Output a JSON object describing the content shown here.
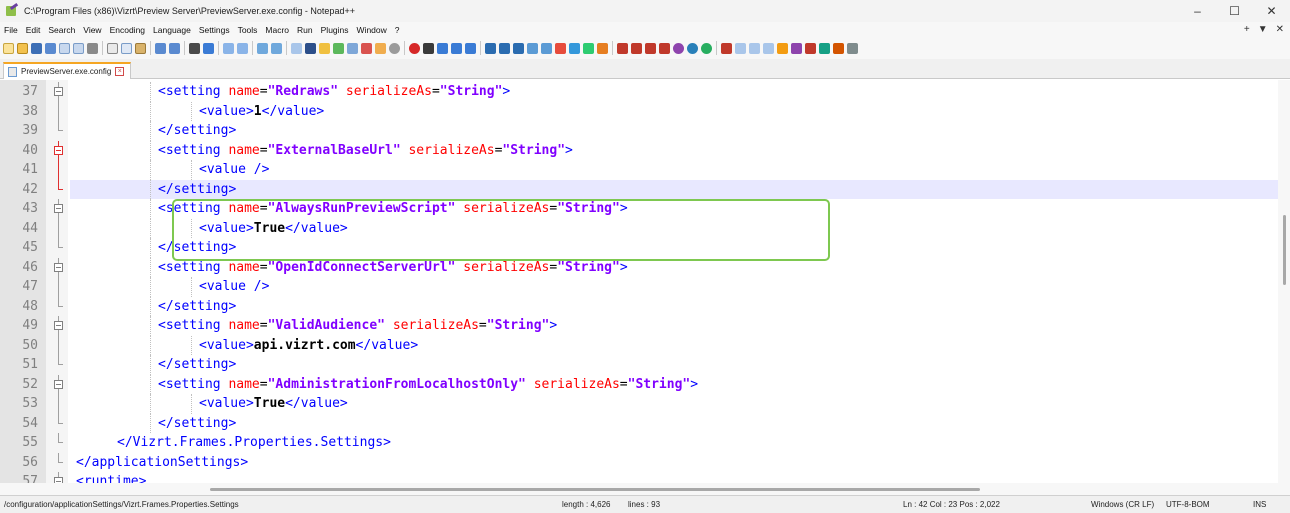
{
  "window": {
    "title": "C:\\Program Files (x86)\\Vizrt\\Preview Server\\PreviewServer.exe.config - Notepad++",
    "controls": [
      "–",
      "☐",
      "✕"
    ]
  },
  "menu": {
    "items": [
      "File",
      "Edit",
      "Search",
      "View",
      "Encoding",
      "Language",
      "Settings",
      "Tools",
      "Macro",
      "Run",
      "Plugins",
      "Window",
      "?"
    ],
    "right": [
      "+",
      "▼",
      "✕"
    ]
  },
  "tab": {
    "label": "PreviewServer.exe.config",
    "close": "×"
  },
  "editor": {
    "lines": [
      {
        "n": "37",
        "indent": 3,
        "parts": [
          [
            "tag",
            "<setting "
          ],
          [
            "attr",
            "name"
          ],
          [
            "eq",
            "="
          ],
          [
            "val",
            "\"Redraws\""
          ],
          [
            "tag",
            " "
          ],
          [
            "attr",
            "serializeAs"
          ],
          [
            "eq",
            "="
          ],
          [
            "val",
            "\"String\""
          ],
          [
            "tag",
            ">"
          ]
        ]
      },
      {
        "n": "38",
        "indent": 4,
        "parts": [
          [
            "tag",
            "<value>"
          ],
          [
            "txt",
            "1"
          ],
          [
            "tag",
            "</value>"
          ]
        ]
      },
      {
        "n": "39",
        "indent": 3,
        "parts": [
          [
            "tag",
            "</setting>"
          ]
        ]
      },
      {
        "n": "40",
        "indent": 3,
        "parts": [
          [
            "tag",
            "<setting "
          ],
          [
            "attr",
            "name"
          ],
          [
            "eq",
            "="
          ],
          [
            "val",
            "\"ExternalBaseUrl\""
          ],
          [
            "tag",
            " "
          ],
          [
            "attr",
            "serializeAs"
          ],
          [
            "eq",
            "="
          ],
          [
            "val",
            "\"String\""
          ],
          [
            "tag",
            ">"
          ]
        ]
      },
      {
        "n": "41",
        "indent": 4,
        "parts": [
          [
            "tag",
            "<value />"
          ]
        ]
      },
      {
        "n": "42",
        "indent": 3,
        "parts": [
          [
            "tag",
            "</setting>"
          ]
        ]
      },
      {
        "n": "43",
        "indent": 3,
        "parts": [
          [
            "tag",
            "<setting "
          ],
          [
            "attr",
            "name"
          ],
          [
            "eq",
            "="
          ],
          [
            "val",
            "\"AlwaysRunPreviewScript\""
          ],
          [
            "tag",
            " "
          ],
          [
            "attr",
            "serializeAs"
          ],
          [
            "eq",
            "="
          ],
          [
            "val",
            "\"String\""
          ],
          [
            "tag",
            ">"
          ]
        ]
      },
      {
        "n": "44",
        "indent": 4,
        "parts": [
          [
            "tag",
            "<value>"
          ],
          [
            "txt",
            "True"
          ],
          [
            "tag",
            "</value>"
          ]
        ]
      },
      {
        "n": "45",
        "indent": 3,
        "parts": [
          [
            "tag",
            "</setting>"
          ]
        ]
      },
      {
        "n": "46",
        "indent": 3,
        "parts": [
          [
            "tag",
            "<setting "
          ],
          [
            "attr",
            "name"
          ],
          [
            "eq",
            "="
          ],
          [
            "val",
            "\"OpenIdConnectServerUrl\""
          ],
          [
            "tag",
            " "
          ],
          [
            "attr",
            "serializeAs"
          ],
          [
            "eq",
            "="
          ],
          [
            "val",
            "\"String\""
          ],
          [
            "tag",
            ">"
          ]
        ]
      },
      {
        "n": "47",
        "indent": 4,
        "parts": [
          [
            "tag",
            "<value />"
          ]
        ]
      },
      {
        "n": "48",
        "indent": 3,
        "parts": [
          [
            "tag",
            "</setting>"
          ]
        ]
      },
      {
        "n": "49",
        "indent": 3,
        "parts": [
          [
            "tag",
            "<setting "
          ],
          [
            "attr",
            "name"
          ],
          [
            "eq",
            "="
          ],
          [
            "val",
            "\"ValidAudience\""
          ],
          [
            "tag",
            " "
          ],
          [
            "attr",
            "serializeAs"
          ],
          [
            "eq",
            "="
          ],
          [
            "val",
            "\"String\""
          ],
          [
            "tag",
            ">"
          ]
        ]
      },
      {
        "n": "50",
        "indent": 4,
        "parts": [
          [
            "tag",
            "<value>"
          ],
          [
            "txt",
            "api.vizrt.com"
          ],
          [
            "tag",
            "</value>"
          ]
        ]
      },
      {
        "n": "51",
        "indent": 3,
        "parts": [
          [
            "tag",
            "</setting>"
          ]
        ]
      },
      {
        "n": "52",
        "indent": 3,
        "parts": [
          [
            "tag",
            "<setting "
          ],
          [
            "attr",
            "name"
          ],
          [
            "eq",
            "="
          ],
          [
            "val",
            "\"AdministrationFromLocalhostOnly\""
          ],
          [
            "tag",
            " "
          ],
          [
            "attr",
            "serializeAs"
          ],
          [
            "eq",
            "="
          ],
          [
            "val",
            "\"String\""
          ],
          [
            "tag",
            ">"
          ]
        ]
      },
      {
        "n": "53",
        "indent": 4,
        "parts": [
          [
            "tag",
            "<value>"
          ],
          [
            "txt",
            "True"
          ],
          [
            "tag",
            "</value>"
          ]
        ]
      },
      {
        "n": "54",
        "indent": 3,
        "parts": [
          [
            "tag",
            "</setting>"
          ]
        ]
      },
      {
        "n": "55",
        "indent": 2,
        "parts": [
          [
            "tag",
            "</Vizrt.Frames.Properties.Settings>"
          ]
        ]
      },
      {
        "n": "56",
        "indent": 1,
        "parts": [
          [
            "tag",
            "</applicationSettings>"
          ]
        ]
      },
      {
        "n": "57",
        "indent": 1,
        "parts": [
          [
            "tag",
            "<runtime>"
          ]
        ]
      }
    ],
    "current_line": "42",
    "highlighted_lines": [
      "43",
      "44",
      "45"
    ]
  },
  "status": {
    "path": "/configuration/applicationSettings/Vizrt.Frames.Properties.Settings",
    "length": "length : 4,626",
    "lines": "lines : 93",
    "cursor": "Ln : 42    Col : 23    Pos : 2,022",
    "eol": "Windows (CR LF)",
    "encoding": "UTF-8-BOM",
    "mode": "INS"
  },
  "colors": {
    "tag": "#0000ff",
    "attr": "#ff0000",
    "value": "#8000ff",
    "highlight_box": "#7ec850",
    "current_line_bg": "#e8e8ff",
    "tab_accent": "#f5a623"
  }
}
